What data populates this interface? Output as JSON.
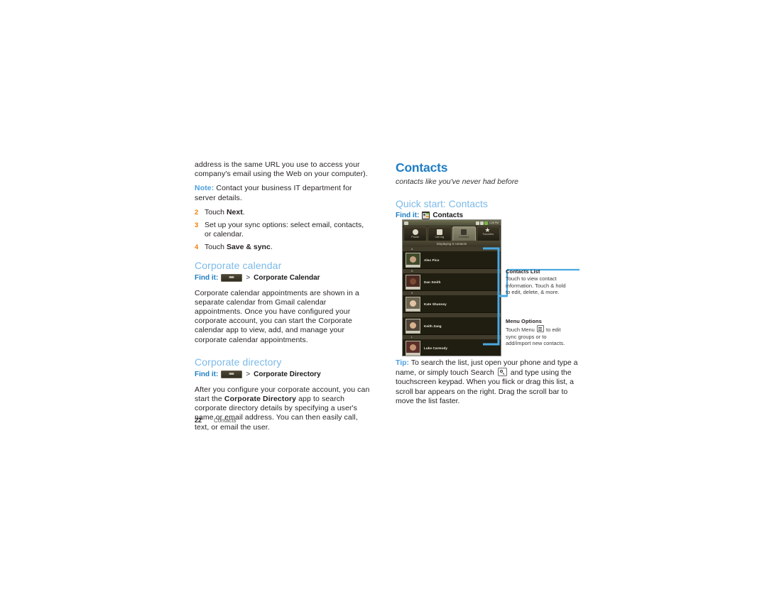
{
  "left_column": {
    "intro_paragraph": "address is the same URL you use to access your company's email using the Web on your computer).",
    "note_label": "Note:",
    "note_text": " Contact your business IT department for server details.",
    "steps": [
      {
        "num": "2",
        "pre": "Touch ",
        "bold": "Next",
        "post": "."
      },
      {
        "num": "3",
        "pre": "Set up your sync options: select email, contacts, or calendar.",
        "bold": "",
        "post": ""
      },
      {
        "num": "4",
        "pre": "Touch ",
        "bold": "Save & sync",
        "post": "."
      }
    ],
    "corporate_calendar": {
      "heading": "Corporate calendar",
      "find_it_label": "Find it:",
      "find_it_icon": "launcher-icon",
      "find_it_separator": ">",
      "find_it_target": "Corporate Calendar",
      "body": "Corporate calendar appointments are shown in a separate calendar from Gmail calendar appointments. Once you have configured your corporate account, you can start the Corporate calendar app to view, add, and manage your corporate calendar appointments."
    },
    "corporate_directory": {
      "heading": "Corporate directory",
      "find_it_label": "Find it:",
      "find_it_icon": "launcher-icon",
      "find_it_separator": ">",
      "find_it_target": "Corporate Directory",
      "body_pre": "After you configure your corporate account, you can start the ",
      "body_bold": "Corporate Directory",
      "body_post": " app to search corporate directory details by specifying a user's name or email address. You can then easily call, text, or email the user."
    }
  },
  "right_column": {
    "chapter_title": "Contacts",
    "chapter_subtitle": "contacts like you've never had before",
    "quick_start_heading": "Quick start: Contacts",
    "find_it_label": "Find it:",
    "find_it_icon": "contacts-app-icon",
    "find_it_target": "Contacts",
    "tip": {
      "lead": "Tip:",
      "text_1": " To search the list, just open your phone and type a name, or simply touch Search ",
      "key_icon": "search-key-icon",
      "text_2": " and type using the touchscreen keypad. When you flick or drag this list, a scroll bar appears on the right. Drag the scroll bar to move the list faster."
    }
  },
  "phone_screenshot": {
    "status_bar": {
      "left_icon": "notification-icon",
      "signal_icon": "signal-icon",
      "wifi_icon": "wifi-icon",
      "battery_icon": "battery-icon",
      "time": "1:26 PM"
    },
    "tabs": [
      {
        "label": "Phone",
        "icon": "dialpad-icon",
        "active": false
      },
      {
        "label": "Call log",
        "icon": "call-log-icon",
        "active": false
      },
      {
        "label": "Contacts",
        "icon": "contacts-icon",
        "active": true
      },
      {
        "label": "Favorites",
        "icon": "star-icon",
        "active": false
      }
    ],
    "banner": "Displaying 5 contacts",
    "list": [
      {
        "letter": "A",
        "name": "Alex Pico",
        "avatar_bg": "#3f4a2a",
        "face": "#c8a184"
      },
      {
        "letter": "D",
        "name": "Dan Smith",
        "avatar_bg": "#4a2a22",
        "face": "#7a4a33"
      },
      {
        "letter": "K",
        "name": "Kate Shunney",
        "avatar_bg": "#6b6450",
        "face": "#e2c4a5"
      },
      {
        "letter": "",
        "name": "Keith Zang",
        "avatar_bg": "#4e4438",
        "face": "#d9b18e"
      },
      {
        "letter": "L",
        "name": "Luke Carmody",
        "avatar_bg": "#5a2f2a",
        "face": "#c39274"
      }
    ]
  },
  "annotations": [
    {
      "title": "Contacts  List",
      "body": "Touch to view contact information. Touch & hold to edit, delete, & more."
    },
    {
      "title": "Menu Options",
      "body_1": "Touch Menu ",
      "icon": "menu-key-icon",
      "body_2": " to edit sync groups or to add/import new contacts."
    }
  ],
  "footer": {
    "page_number": "22",
    "chapter": "Contacts"
  },
  "colors": {
    "accent_blue": "#1f7ec4",
    "light_blue": "#7cb9e8",
    "note_blue": "#4a9fe0",
    "step_orange": "#f07d00",
    "callout_blue": "#4aa8e0",
    "text": "#231f20"
  }
}
